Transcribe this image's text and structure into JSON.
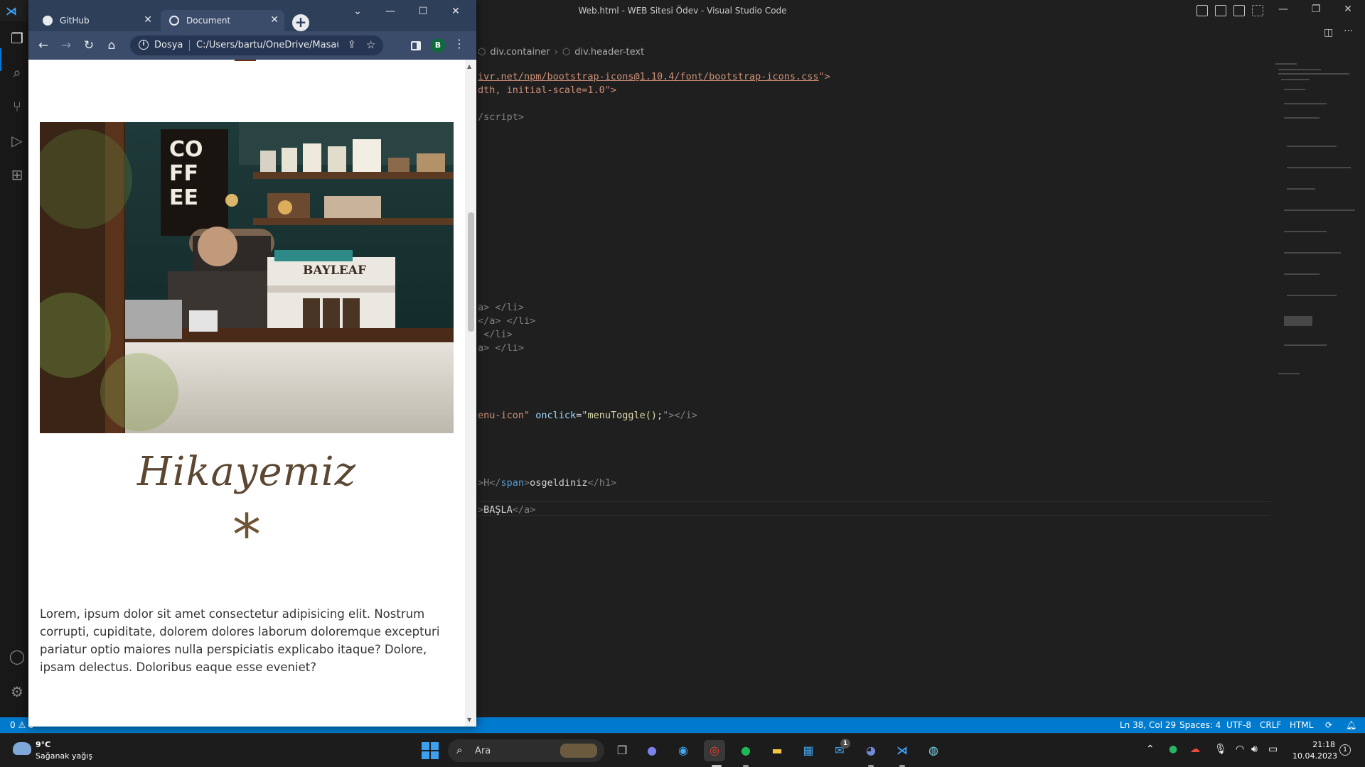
{
  "vscode": {
    "window_title": "Web.html - WEB Sitesi Ödev - Visual Studio Code",
    "breadcrumb": [
      "div.container",
      "div.header-text"
    ],
    "code": {
      "line1_url": "ivr.net/npm/bootstrap-icons@1.10.4/font/bootstrap-icons.css",
      "line1_end": "\">",
      "line2": "dth, initial-scale=1.0\">",
      "line3_close": "/script>",
      "li1": "a> </li>",
      "li2": "</a> </li>",
      "li3": " </li>",
      "li4": "a> </li>",
      "menu_cls": "enu-icon\"",
      "menu_attr": "onclick",
      "menu_eq": "=\"",
      "menu_fn": "menuToggle();",
      "menu_end": "\"></i>",
      "h1_a": ">H</",
      "h1_span": "span",
      "h1_b": ">",
      "h1_text": "osgeldiniz",
      "h1_close": "</h1>",
      "basla_a": ">",
      "basla_text": "BAŞLA",
      "basla_close": "</a>"
    },
    "status": {
      "problems": "0 ⚠ 0",
      "position": "Ln 38, Col 29",
      "spaces": "Spaces: 4",
      "encoding": "UTF-8",
      "eol": "CRLF",
      "language": "HTML"
    },
    "accent": "#007acc"
  },
  "chrome": {
    "tabs": [
      {
        "label": "GitHub",
        "icon": "github-icon"
      },
      {
        "label": "Document",
        "icon": "globe-icon"
      }
    ],
    "omnibox": {
      "label": "Dosya",
      "url": "C:/Users/bartu/OneDrive/Masaüst..."
    },
    "profile_initial": "B"
  },
  "page": {
    "photo_sign": "BAYLEAF",
    "photo_board": "CO FF EE",
    "title": "Hikayemiz",
    "asterisk": "*",
    "paragraph": "Lorem, ipsum dolor sit amet consectetur adipisicing elit. Nostrum corrupti, cupiditate, dolorem dolores laborum doloremque excepturi pariatur optio maiores nulla perspiciatis explicabo itaque? Dolore, ipsam delectus. Doloribus eaque esse eveniet?"
  },
  "taskbar": {
    "weather_temp": "9°C",
    "weather_desc": "Sağanak yağış",
    "search_placeholder": "Ara",
    "time": "21:18",
    "date": "10.04.2023",
    "notification_count": "1",
    "mail_badge": "1"
  }
}
